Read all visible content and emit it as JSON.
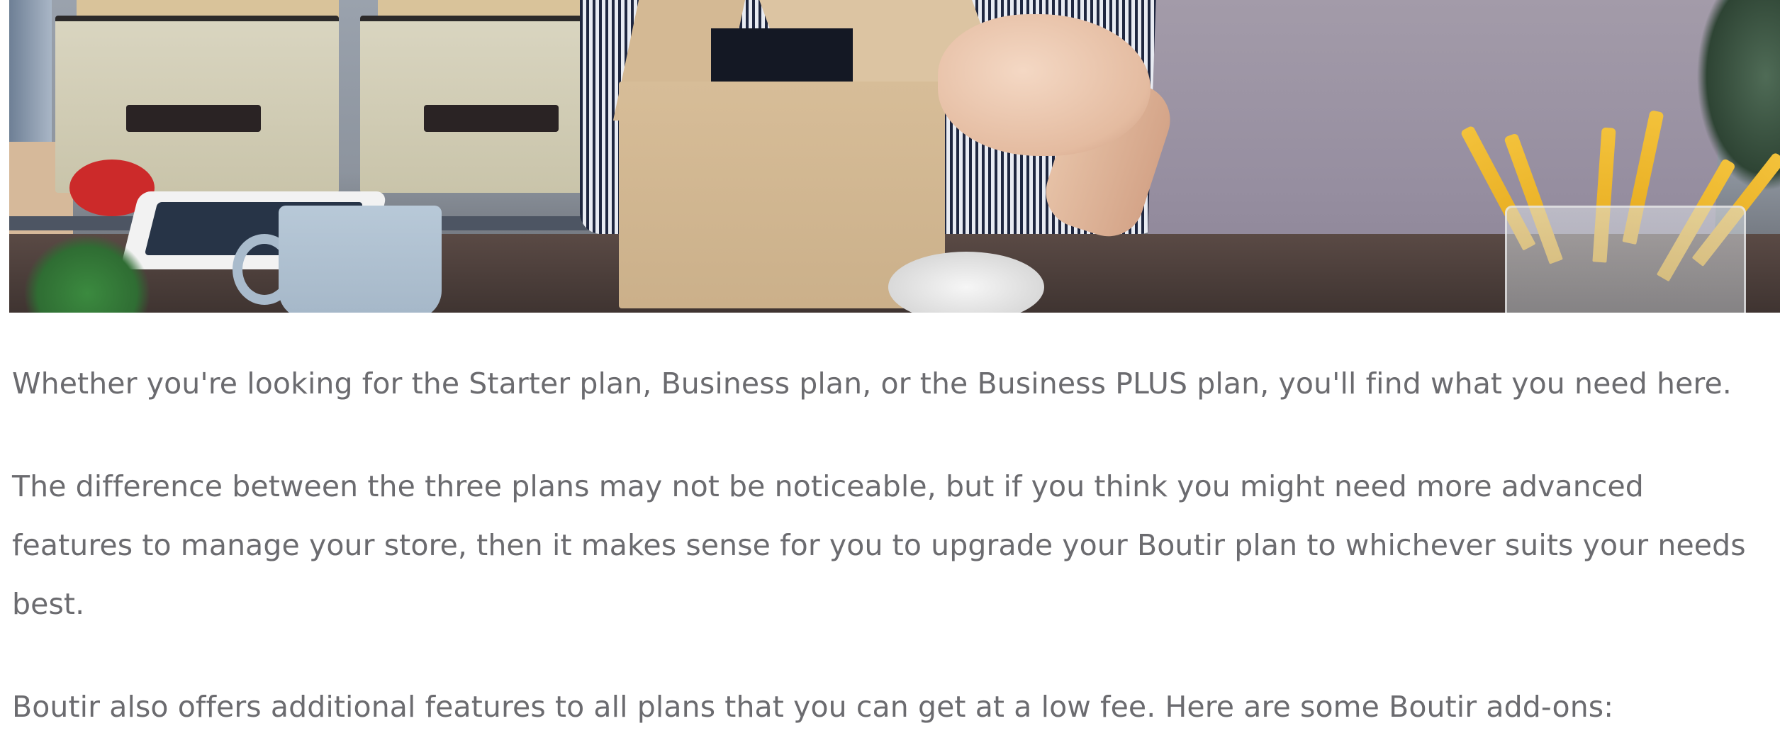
{
  "hero": {
    "image_description_icon": "photo-icon"
  },
  "article": {
    "paragraphs": [
      "Whether you're looking for the Starter plan, Business plan, or the Business PLUS plan, you'll find what you need here.",
      "The difference between the three plans may not be noticeable, but if you think you might need more advanced features to manage your store, then it makes sense for you to upgrade your Boutir plan to whichever suits your needs best.",
      "Boutir also offers additional features to all plans that you can get at a low fee. Here are some Boutir add-ons:"
    ]
  },
  "colors": {
    "text": "#6b6b6f",
    "background": "#ffffff"
  }
}
